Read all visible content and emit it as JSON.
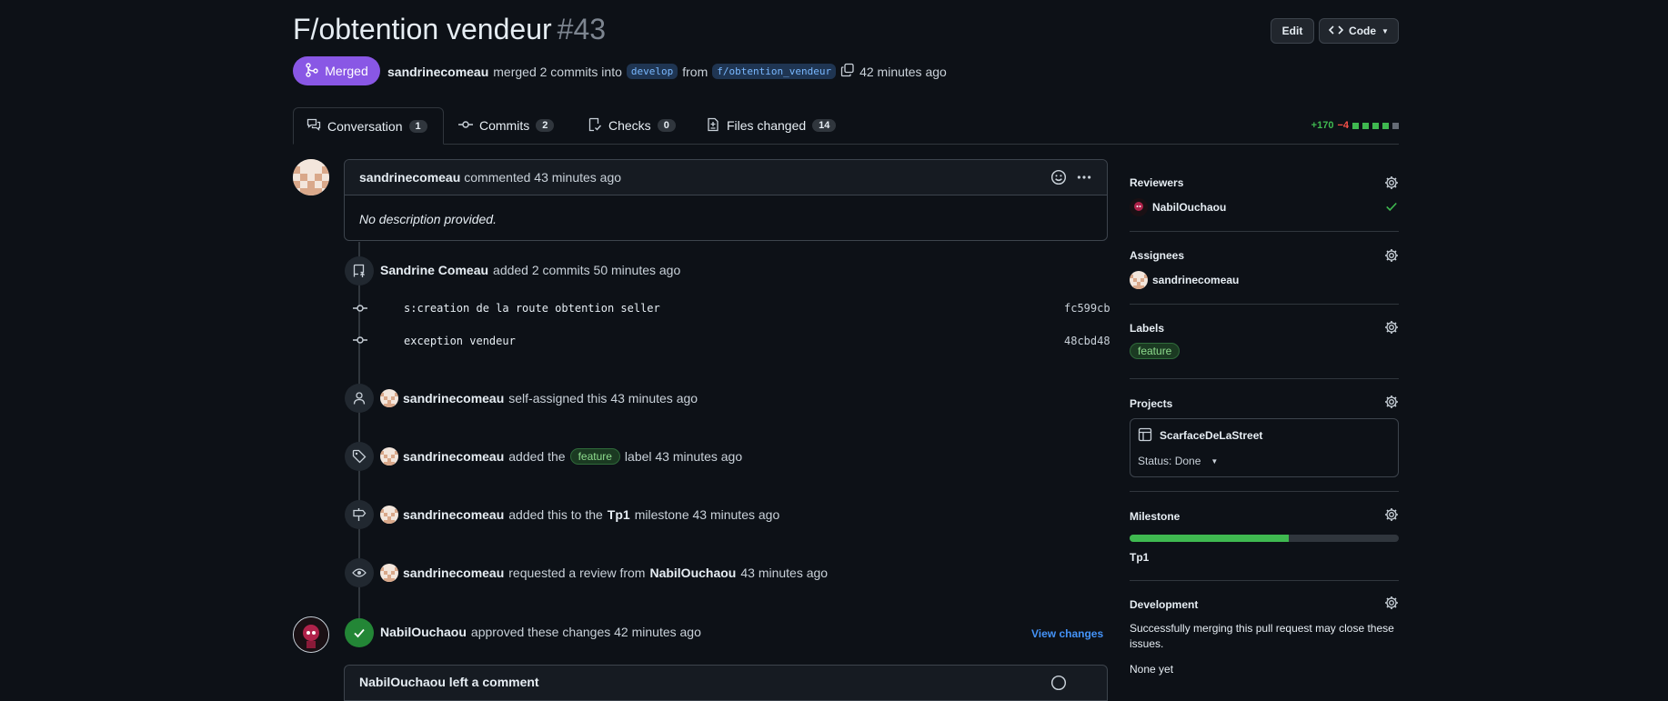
{
  "header": {
    "title": "F/obtention vendeur",
    "number": "#43",
    "edit_label": "Edit",
    "code_label": "Code"
  },
  "status": {
    "badge": "Merged",
    "author": "sandrinecomeau",
    "merged_text": "merged 2 commits into",
    "base_branch": "develop",
    "from_text": "from",
    "head_branch": "f/obtention_vendeur",
    "time": "42 minutes ago"
  },
  "tabs": [
    {
      "label": "Conversation",
      "count": "1"
    },
    {
      "label": "Commits",
      "count": "2"
    },
    {
      "label": "Checks",
      "count": "0"
    },
    {
      "label": "Files changed",
      "count": "14"
    }
  ],
  "diffstat": {
    "additions": "+170",
    "deletions": "−4"
  },
  "comment": {
    "author": "sandrinecomeau",
    "meta": "commented 43 minutes ago",
    "body": "No description provided."
  },
  "timeline": {
    "commits_event": {
      "author": "Sandrine Comeau",
      "text": "added 2 commits 50 minutes ago"
    },
    "commits": [
      {
        "message": "s:creation de la route obtention seller",
        "sha": "fc599cb"
      },
      {
        "message": "exception vendeur",
        "sha": "48cbd48"
      }
    ],
    "assign_event": {
      "author": "sandrinecomeau",
      "text": "self-assigned this 43 minutes ago"
    },
    "label_event": {
      "author": "sandrinecomeau",
      "pre": "added the",
      "label": "feature",
      "post": "label 43 minutes ago"
    },
    "milestone_event": {
      "author": "sandrinecomeau",
      "pre": "added this to the",
      "milestone": "Tp1",
      "post": "milestone 43 minutes ago"
    },
    "review_request_event": {
      "author": "sandrinecomeau",
      "pre": "requested a review from",
      "reviewer": "NabilOuchaou",
      "post": "43 minutes ago"
    },
    "approval_event": {
      "author": "NabilOuchaou",
      "text": "approved these changes 42 minutes ago",
      "view_changes": "View changes"
    },
    "partial_comment": "NabilOuchaou left a comment"
  },
  "sidebar": {
    "reviewers": {
      "title": "Reviewers",
      "name": "NabilOuchaou"
    },
    "assignees": {
      "title": "Assignees",
      "name": "sandrinecomeau"
    },
    "labels": {
      "title": "Labels",
      "label": "feature"
    },
    "projects": {
      "title": "Projects",
      "project": "ScarfaceDeLaStreet",
      "status": "Status: Done"
    },
    "milestone": {
      "title": "Milestone",
      "name": "Tp1",
      "progress": 0.59
    },
    "development": {
      "title": "Development",
      "text": "Successfully merging this pull request may close these issues.",
      "none": "None yet"
    }
  },
  "colors": {
    "merged": "#8957e5",
    "success": "#238636",
    "accent": "#4493f8"
  }
}
